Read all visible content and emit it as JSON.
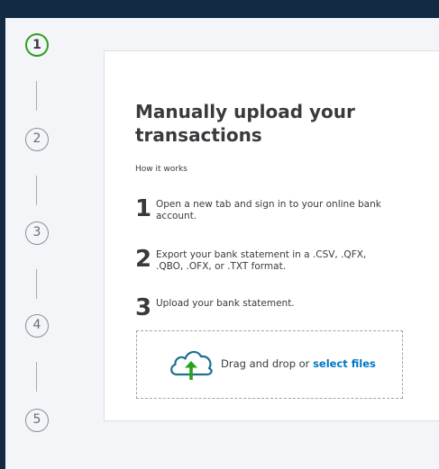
{
  "stepper": {
    "steps": [
      {
        "label": "1",
        "active": true
      },
      {
        "label": "2",
        "active": false
      },
      {
        "label": "3",
        "active": false
      },
      {
        "label": "4",
        "active": false
      },
      {
        "label": "5",
        "active": false
      }
    ],
    "active_color": "#2ca01c"
  },
  "card": {
    "title": "Manually upload your transactions",
    "how_it_works": "How it works",
    "steps": [
      {
        "number": "1",
        "text": "Open a new tab and sign in to your online bank account."
      },
      {
        "number": "2",
        "text": "Export your bank statement in a .CSV, .QFX, .QBO, .OFX, or .TXT format."
      },
      {
        "number": "3",
        "text": "Upload your bank statement."
      }
    ]
  },
  "dropzone": {
    "icon": "cloud-upload-icon",
    "prefix": "Drag and drop or",
    "link": "select files",
    "link_color": "#0077c5"
  }
}
